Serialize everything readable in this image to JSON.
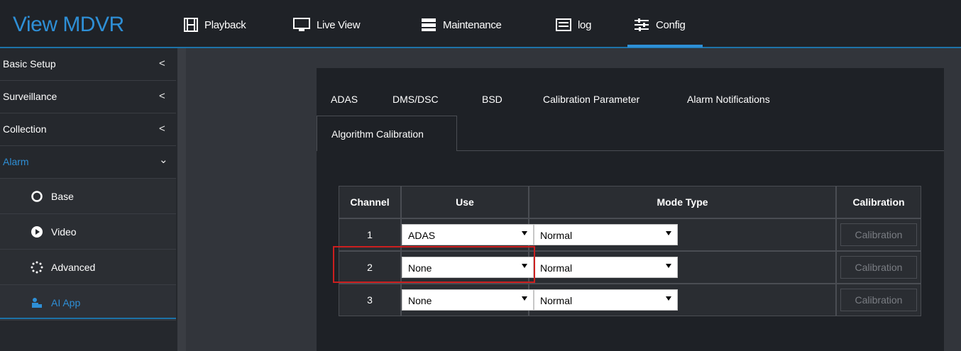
{
  "app": {
    "brand": "View MDVR"
  },
  "nav": {
    "items": [
      {
        "label": "Playback",
        "icon": "film-icon"
      },
      {
        "label": "Live View",
        "icon": "monitor-icon"
      },
      {
        "label": "Maintenance",
        "icon": "server-icon"
      },
      {
        "label": "log",
        "icon": "log-icon"
      },
      {
        "label": "Config",
        "icon": "sliders-icon",
        "active": true
      }
    ]
  },
  "sidebar": {
    "groups": [
      {
        "label": "Basic Setup",
        "chevron": "<"
      },
      {
        "label": "Surveillance",
        "chevron": "<"
      },
      {
        "label": "Collection",
        "chevron": "<"
      },
      {
        "label": "Alarm",
        "chevron": "⌄",
        "open": true
      }
    ],
    "sub_items": [
      {
        "label": "Base",
        "icon": "circle-icon"
      },
      {
        "label": "Video",
        "icon": "video-icon"
      },
      {
        "label": "Advanced",
        "icon": "spinner-icon"
      },
      {
        "label": "AI App",
        "icon": "ai-app-icon",
        "active": true
      }
    ]
  },
  "tabs": {
    "items": [
      "ADAS",
      "DMS/DSC",
      "BSD",
      "Calibration Parameter",
      "Alarm Notifications"
    ],
    "active": "Algorithm Calibration"
  },
  "table": {
    "headers": {
      "channel": "Channel",
      "use": "Use",
      "mode": "Mode Type",
      "calibration": "Calibration"
    },
    "rows": [
      {
        "channel": "1",
        "use": "ADAS",
        "mode": "Normal",
        "calibration": "Calibration"
      },
      {
        "channel": "2",
        "use": "None",
        "mode": "Normal",
        "calibration": "Calibration"
      },
      {
        "channel": "3",
        "use": "None",
        "mode": "Normal",
        "calibration": "Calibration"
      }
    ]
  },
  "colors": {
    "accent": "#2e8fd6",
    "highlight": "#cc1f1f"
  }
}
